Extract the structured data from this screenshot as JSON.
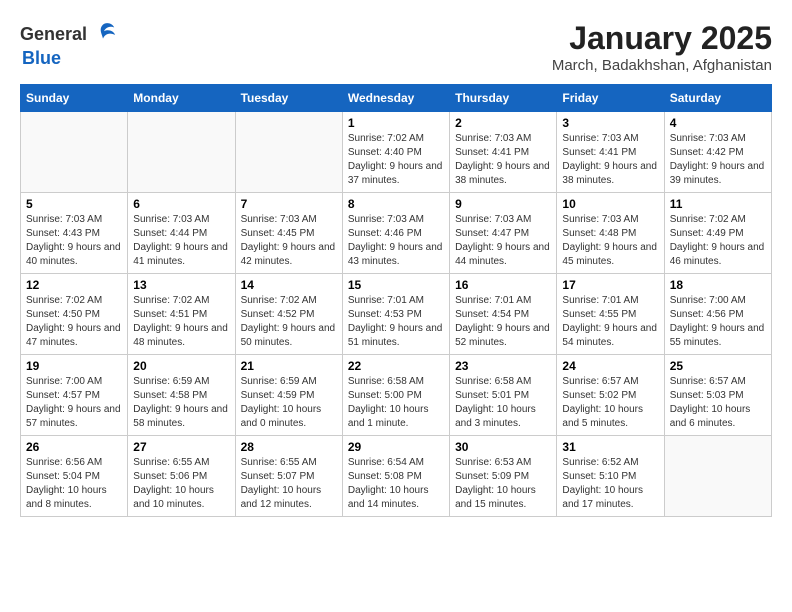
{
  "header": {
    "logo_general": "General",
    "logo_blue": "Blue",
    "month_title": "January 2025",
    "location": "March, Badakhshan, Afghanistan"
  },
  "days_of_week": [
    "Sunday",
    "Monday",
    "Tuesday",
    "Wednesday",
    "Thursday",
    "Friday",
    "Saturday"
  ],
  "weeks": [
    [
      {
        "day": "",
        "info": ""
      },
      {
        "day": "",
        "info": ""
      },
      {
        "day": "",
        "info": ""
      },
      {
        "day": "1",
        "info": "Sunrise: 7:02 AM\nSunset: 4:40 PM\nDaylight: 9 hours and 37 minutes."
      },
      {
        "day": "2",
        "info": "Sunrise: 7:03 AM\nSunset: 4:41 PM\nDaylight: 9 hours and 38 minutes."
      },
      {
        "day": "3",
        "info": "Sunrise: 7:03 AM\nSunset: 4:41 PM\nDaylight: 9 hours and 38 minutes."
      },
      {
        "day": "4",
        "info": "Sunrise: 7:03 AM\nSunset: 4:42 PM\nDaylight: 9 hours and 39 minutes."
      }
    ],
    [
      {
        "day": "5",
        "info": "Sunrise: 7:03 AM\nSunset: 4:43 PM\nDaylight: 9 hours and 40 minutes."
      },
      {
        "day": "6",
        "info": "Sunrise: 7:03 AM\nSunset: 4:44 PM\nDaylight: 9 hours and 41 minutes."
      },
      {
        "day": "7",
        "info": "Sunrise: 7:03 AM\nSunset: 4:45 PM\nDaylight: 9 hours and 42 minutes."
      },
      {
        "day": "8",
        "info": "Sunrise: 7:03 AM\nSunset: 4:46 PM\nDaylight: 9 hours and 43 minutes."
      },
      {
        "day": "9",
        "info": "Sunrise: 7:03 AM\nSunset: 4:47 PM\nDaylight: 9 hours and 44 minutes."
      },
      {
        "day": "10",
        "info": "Sunrise: 7:03 AM\nSunset: 4:48 PM\nDaylight: 9 hours and 45 minutes."
      },
      {
        "day": "11",
        "info": "Sunrise: 7:02 AM\nSunset: 4:49 PM\nDaylight: 9 hours and 46 minutes."
      }
    ],
    [
      {
        "day": "12",
        "info": "Sunrise: 7:02 AM\nSunset: 4:50 PM\nDaylight: 9 hours and 47 minutes."
      },
      {
        "day": "13",
        "info": "Sunrise: 7:02 AM\nSunset: 4:51 PM\nDaylight: 9 hours and 48 minutes."
      },
      {
        "day": "14",
        "info": "Sunrise: 7:02 AM\nSunset: 4:52 PM\nDaylight: 9 hours and 50 minutes."
      },
      {
        "day": "15",
        "info": "Sunrise: 7:01 AM\nSunset: 4:53 PM\nDaylight: 9 hours and 51 minutes."
      },
      {
        "day": "16",
        "info": "Sunrise: 7:01 AM\nSunset: 4:54 PM\nDaylight: 9 hours and 52 minutes."
      },
      {
        "day": "17",
        "info": "Sunrise: 7:01 AM\nSunset: 4:55 PM\nDaylight: 9 hours and 54 minutes."
      },
      {
        "day": "18",
        "info": "Sunrise: 7:00 AM\nSunset: 4:56 PM\nDaylight: 9 hours and 55 minutes."
      }
    ],
    [
      {
        "day": "19",
        "info": "Sunrise: 7:00 AM\nSunset: 4:57 PM\nDaylight: 9 hours and 57 minutes."
      },
      {
        "day": "20",
        "info": "Sunrise: 6:59 AM\nSunset: 4:58 PM\nDaylight: 9 hours and 58 minutes."
      },
      {
        "day": "21",
        "info": "Sunrise: 6:59 AM\nSunset: 4:59 PM\nDaylight: 10 hours and 0 minutes."
      },
      {
        "day": "22",
        "info": "Sunrise: 6:58 AM\nSunset: 5:00 PM\nDaylight: 10 hours and 1 minute."
      },
      {
        "day": "23",
        "info": "Sunrise: 6:58 AM\nSunset: 5:01 PM\nDaylight: 10 hours and 3 minutes."
      },
      {
        "day": "24",
        "info": "Sunrise: 6:57 AM\nSunset: 5:02 PM\nDaylight: 10 hours and 5 minutes."
      },
      {
        "day": "25",
        "info": "Sunrise: 6:57 AM\nSunset: 5:03 PM\nDaylight: 10 hours and 6 minutes."
      }
    ],
    [
      {
        "day": "26",
        "info": "Sunrise: 6:56 AM\nSunset: 5:04 PM\nDaylight: 10 hours and 8 minutes."
      },
      {
        "day": "27",
        "info": "Sunrise: 6:55 AM\nSunset: 5:06 PM\nDaylight: 10 hours and 10 minutes."
      },
      {
        "day": "28",
        "info": "Sunrise: 6:55 AM\nSunset: 5:07 PM\nDaylight: 10 hours and 12 minutes."
      },
      {
        "day": "29",
        "info": "Sunrise: 6:54 AM\nSunset: 5:08 PM\nDaylight: 10 hours and 14 minutes."
      },
      {
        "day": "30",
        "info": "Sunrise: 6:53 AM\nSunset: 5:09 PM\nDaylight: 10 hours and 15 minutes."
      },
      {
        "day": "31",
        "info": "Sunrise: 6:52 AM\nSunset: 5:10 PM\nDaylight: 10 hours and 17 minutes."
      },
      {
        "day": "",
        "info": ""
      }
    ]
  ]
}
